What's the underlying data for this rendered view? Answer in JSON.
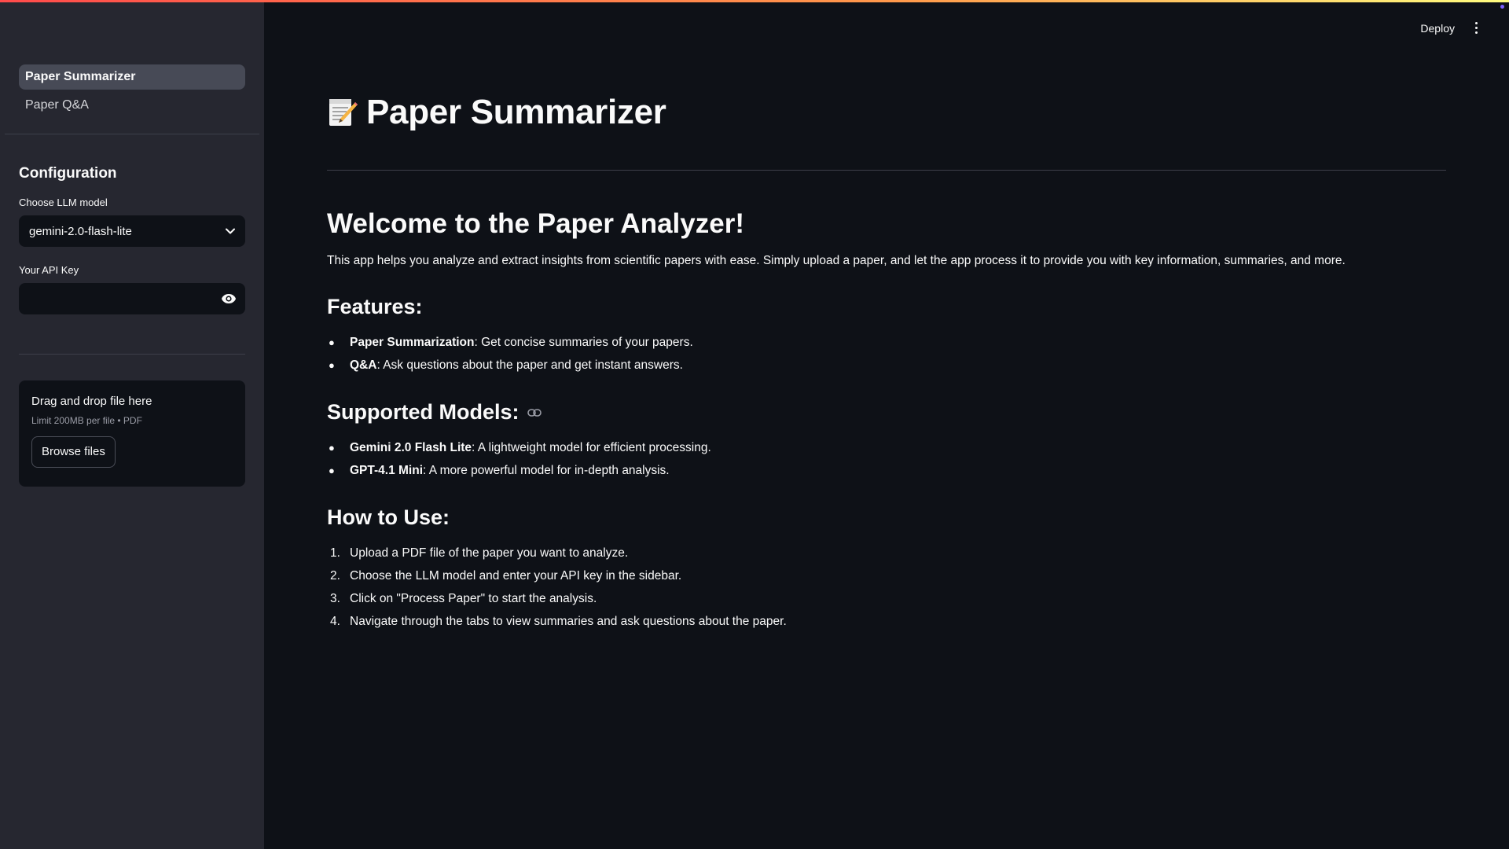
{
  "sidebar": {
    "nav": [
      {
        "label": "Paper Summarizer",
        "active": true
      },
      {
        "label": "Paper Q&A",
        "active": false
      }
    ],
    "config_title": "Configuration",
    "model_label": "Choose LLM model",
    "model_value": "gemini-2.0-flash-lite",
    "api_key_label": "Your API Key",
    "api_key_value": "",
    "uploader": {
      "title": "Drag and drop file here",
      "limit": "Limit 200MB per file • PDF",
      "button": "Browse files"
    }
  },
  "header": {
    "deploy": "Deploy",
    "menu_icon": "kebab-menu-icon"
  },
  "main": {
    "title": "Paper Summarizer",
    "title_icon": "memo-icon",
    "welcome": "Welcome to the Paper Analyzer!",
    "intro": "This app helps you analyze and extract insights from scientific papers with ease. Simply upload a paper, and let the app process it to provide you with key information, summaries, and more.",
    "features_heading": "Features:",
    "features": [
      {
        "name": "Paper Summarization",
        "desc": ": Get concise summaries of your papers."
      },
      {
        "name": "Q&A",
        "desc": ": Ask questions about the paper and get instant answers."
      }
    ],
    "models_heading": "Supported Models:",
    "models": [
      {
        "name": "Gemini 2.0 Flash Lite",
        "desc": ": A lightweight model for efficient processing."
      },
      {
        "name": "GPT-4.1 Mini",
        "desc": ": A more powerful model for in-depth analysis."
      }
    ],
    "howto_heading": "How to Use:",
    "steps": [
      {
        "num": "1.",
        "text": "Upload a PDF file of the paper you want to analyze."
      },
      {
        "num": "2.",
        "text": "Choose the LLM model and enter your API key in the sidebar."
      },
      {
        "num": "3.",
        "text": "Click on \"Process Paper\" to start the analysis."
      },
      {
        "num": "4.",
        "text": "Navigate through the tabs to view summaries and ask questions about the paper."
      }
    ]
  },
  "colors": {
    "background": "#0e1117",
    "sidebar": "#262730",
    "active_nav": "#474a56",
    "text": "#fafafa"
  }
}
